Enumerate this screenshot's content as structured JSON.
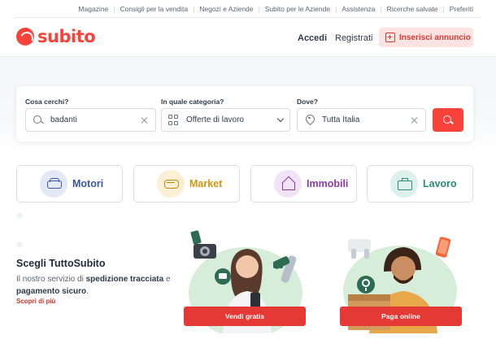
{
  "topbar": {
    "links": [
      "Magazine",
      "Consigli per la vendita",
      "Negozi e Aziende",
      "Subito per le Aziende",
      "Assistenza",
      "Ricerche salvate",
      "Preferiti"
    ]
  },
  "header": {
    "logo_text": "subito",
    "login_label": "Accedi",
    "register_label": "Registrati",
    "insert_ad_label": "Inserisci annuncio",
    "brand_color": "#f9423a"
  },
  "search": {
    "what_label": "Cosa cerchi?",
    "what_value": "badanti",
    "category_label": "In quale categoria?",
    "category_value": "Offerte di lavoro",
    "where_label": "Dove?",
    "where_value": "Tutta Italia"
  },
  "categories": [
    {
      "label": "Motori",
      "color": "#3c56a6",
      "bg": "#e3e8f7",
      "icon": "car-icon"
    },
    {
      "label": "Market",
      "color": "#d29510",
      "bg": "#fbf0d6",
      "icon": "sofa-icon"
    },
    {
      "label": "Immobili",
      "color": "#8d3aa8",
      "bg": "#f1e3f6",
      "icon": "house-icon"
    },
    {
      "label": "Lavoro",
      "color": "#2c8c78",
      "bg": "#dcf1ec",
      "icon": "briefcase-icon"
    }
  ],
  "promo": {
    "title": "Scegli TuttoSubito",
    "desc_prefix": "Il nostro servizio di ",
    "desc_bold1": "spedizione tracciata",
    "desc_mid": " e ",
    "desc_bold2": "pagamento sicuro",
    "desc_suffix": ".",
    "link": "Scopri di più",
    "sell_button": "Vendi gratis",
    "pay_button": "Paga online"
  }
}
